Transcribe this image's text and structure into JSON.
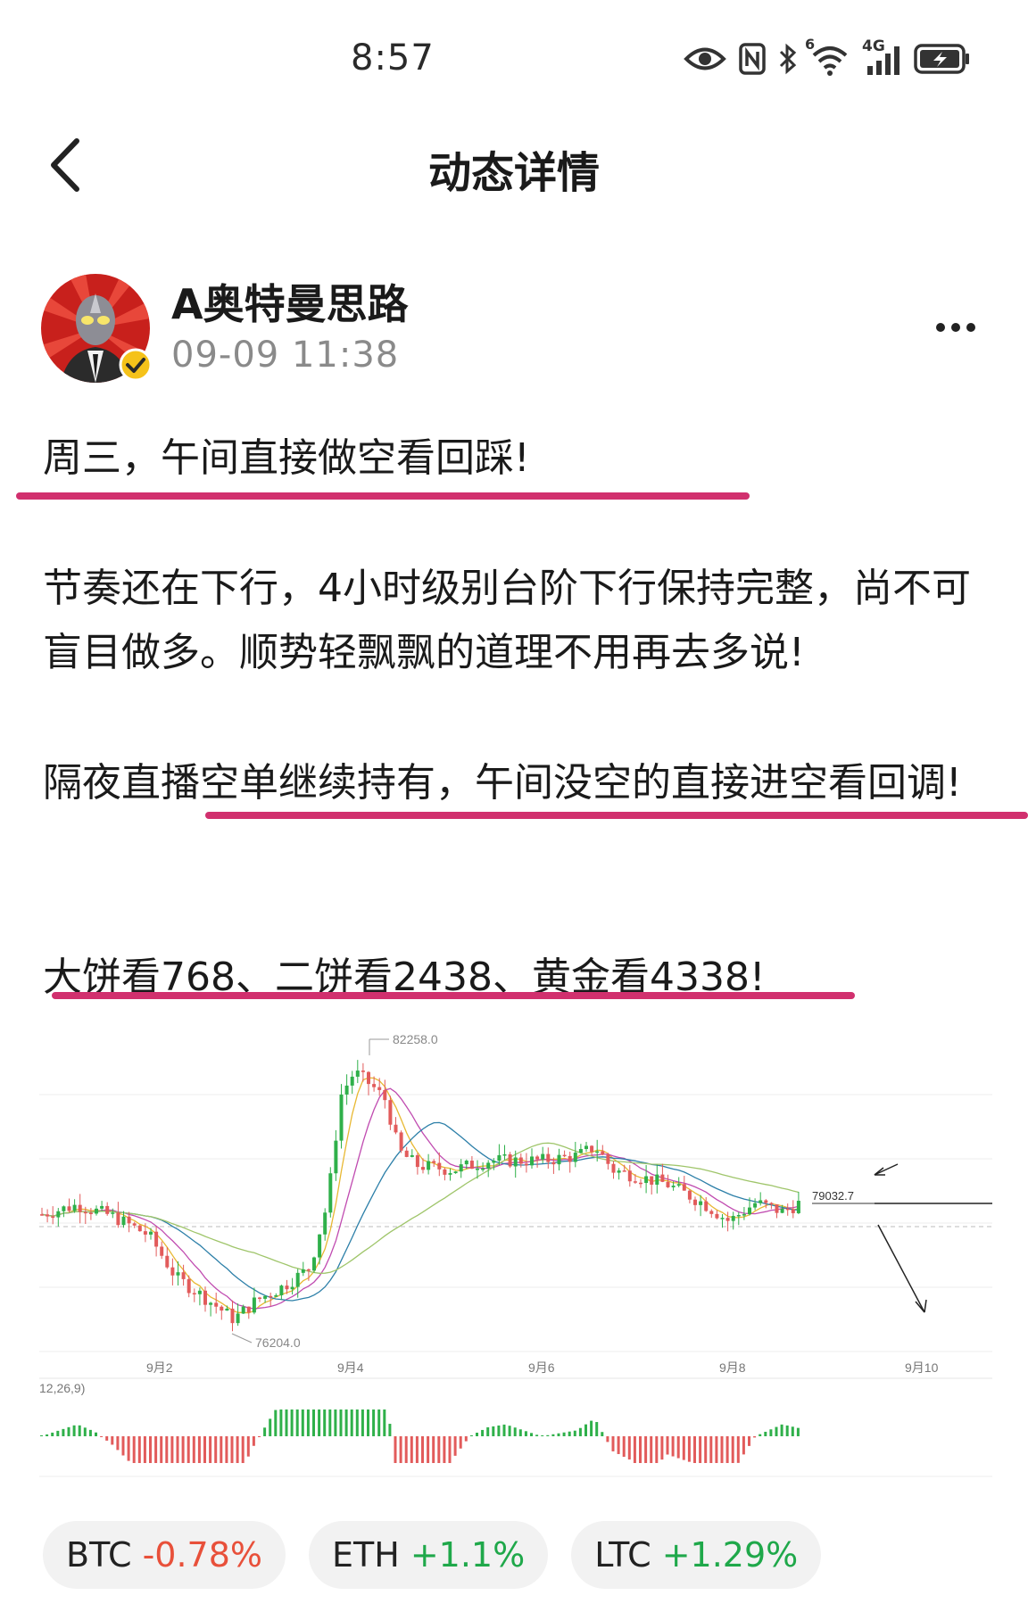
{
  "status_bar": {
    "time": "8:57",
    "icons": [
      "eye-icon",
      "nfc-icon",
      "bluetooth-icon",
      "wifi-6-icon",
      "signal-4g-icon",
      "battery-charging-icon"
    ],
    "wifi_label": "6",
    "network_label": "4G"
  },
  "header": {
    "title": "动态详情",
    "back_icon": "chevron-left-icon"
  },
  "author": {
    "name": "A奥特曼思路",
    "time": "09-09 11:38",
    "verified": true
  },
  "post": {
    "p1": "周三，午间直接做空看回踩!",
    "p2": "节奏还在下行，4小时级别台阶下行保持完整，尚不可盲目做多。顺势轻飘飘的道理不用再去多说!",
    "p3": "隔夜直播空单继续持有，午间没空的直接进空看回调!",
    "p4": "大饼看768、二饼看2438、黄金看4338!",
    "highlight_color": "#d1306e"
  },
  "chart_data": {
    "type": "candlestick",
    "high_label": "82258.0",
    "low_label": "76204.0",
    "current_label": "79032.7",
    "x_ticks": [
      "9月2",
      "9月4",
      "9月6",
      "9月8",
      "9月10"
    ],
    "indicator_label": "12,26,9)",
    "high": 82258.0,
    "low": 76204.0,
    "current": 79032.7,
    "colors": {
      "up": "#2fb04a",
      "down": "#e25b5b",
      "annotation": "#222222"
    }
  },
  "tags": [
    {
      "symbol": "BTC",
      "change": "-0.78%",
      "direction": "down"
    },
    {
      "symbol": "ETH",
      "change": "+1.1%",
      "direction": "up"
    },
    {
      "symbol": "LTC",
      "change": "+1.29%",
      "direction": "up"
    }
  ]
}
